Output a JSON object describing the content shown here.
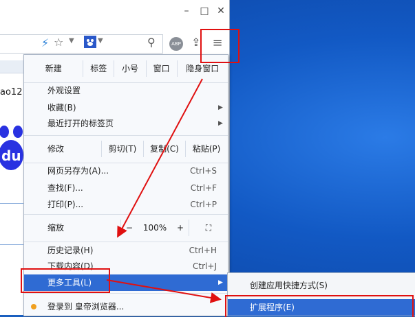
{
  "window": {
    "minimize": "–",
    "maximize": "□",
    "close": "✕"
  },
  "toolbar": {
    "abp_label": "ABP",
    "page_partial_text": "ao12"
  },
  "logo_text": "du",
  "menu": {
    "row1": [
      "新建",
      "标签",
      "小号",
      "窗口",
      "隐身窗口"
    ],
    "items_group1": [
      {
        "label": "外观设置",
        "has_submenu": false
      },
      {
        "label": "收藏(B)",
        "has_submenu": true
      },
      {
        "label": "最近打开的标签页",
        "has_submenu": true
      }
    ],
    "edit": {
      "label": "修改",
      "cut": "剪切(T)",
      "copy": "复制(C)",
      "paste": "粘贴(P)"
    },
    "items_group2": [
      {
        "label": "网页另存为(A)...",
        "shortcut": "Ctrl+S"
      },
      {
        "label": "查找(F)...",
        "shortcut": "Ctrl+F"
      },
      {
        "label": "打印(P)...",
        "shortcut": "Ctrl+P"
      }
    ],
    "zoom": {
      "label": "缩放",
      "minus": "−",
      "value": "100%",
      "plus": "+",
      "fullscreen": "⛶"
    },
    "items_group3": [
      {
        "label": "历史记录(H)",
        "shortcut": "Ctrl+H"
      },
      {
        "label": "下载内容(D)",
        "shortcut": "Ctrl+J"
      }
    ],
    "more_tools": "更多工具(L)",
    "login": "登录到 皇帝浏览器..."
  },
  "submenu": {
    "items": [
      "创建应用快捷方式(S)",
      "扩展程序(E)"
    ]
  },
  "colors": {
    "highlight": "#2f6bd3",
    "annotation_red": "#e01010"
  }
}
